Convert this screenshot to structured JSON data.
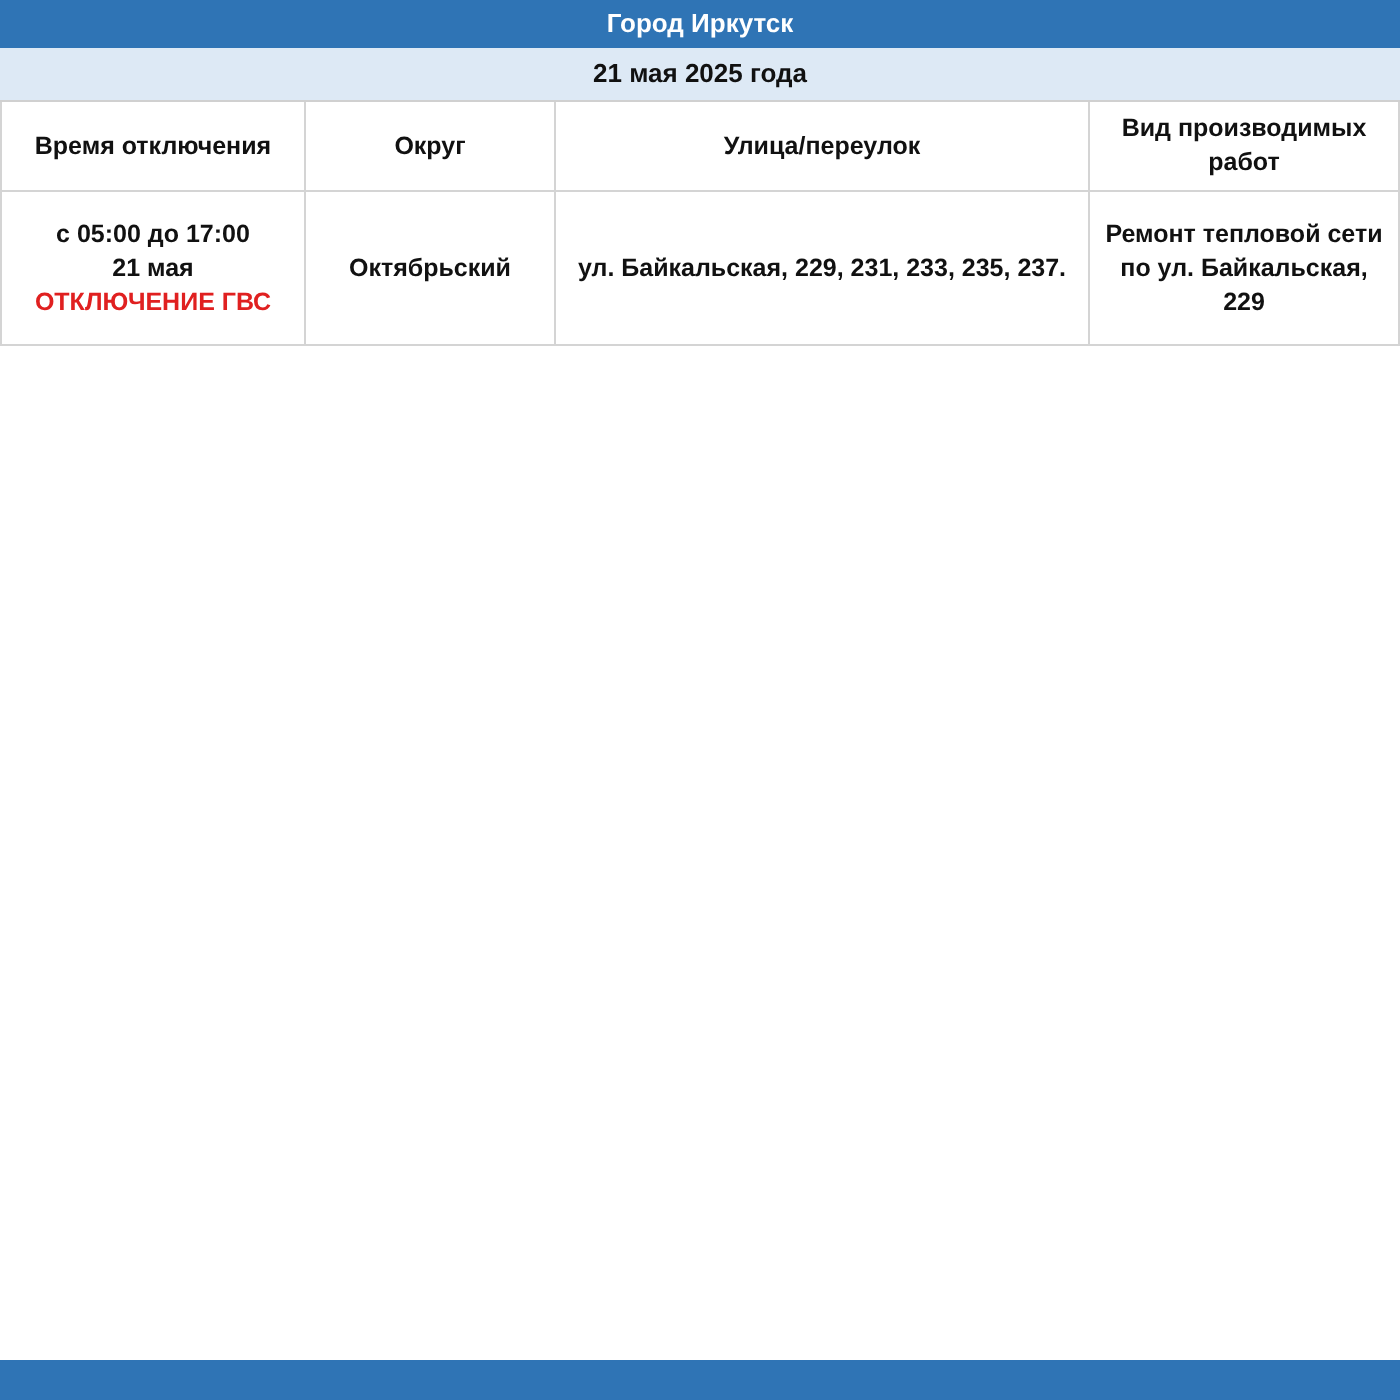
{
  "title": "Город Иркутск",
  "date": "21 мая 2025 года",
  "table": {
    "columns": [
      "Время отключения",
      "Округ",
      "Улица/переулок",
      "Вид производимых работ"
    ],
    "rows": [
      {
        "time": [
          {
            "text": "с 05:00 до 17:00",
            "kind": "normal"
          },
          {
            "text": "21 мая",
            "kind": "normal"
          },
          {
            "text": "ОТКЛЮЧЕНИЕ ГВС",
            "kind": "alert"
          }
        ],
        "district": "Октябрьский",
        "street": "ул. Байкальская, 229, 231, 233, 235, 237.",
        "work": "Ремонт тепловой сети по ул. Байкальская, 229"
      }
    ]
  }
}
